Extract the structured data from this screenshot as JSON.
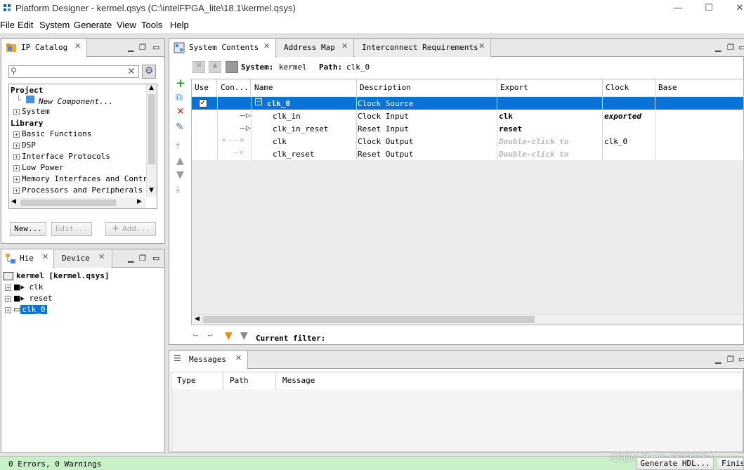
{
  "window": {
    "title": "Platform Designer - kermel.qsys (C:\\intelFPGA_lite\\18.1\\kermel.qsys)",
    "minimize": "—",
    "maximize": "☐",
    "close": "✕"
  },
  "menu": [
    "File",
    "Edit",
    "System",
    "Generate",
    "View",
    "Tools",
    "Help"
  ],
  "ip_catalog": {
    "tab_label": "IP Catalog",
    "search_placeholder": "",
    "project_heading": "Project",
    "new_component": "New Component...",
    "system": "System",
    "library_heading": "Library",
    "library_items": [
      "Basic Functions",
      "DSP",
      "Interface Protocols",
      "Low Power",
      "Memory Interfaces and Control",
      "Processors and Peripherals"
    ],
    "buttons": {
      "new": "New...",
      "edit": "Edit...",
      "add": "Add..."
    }
  },
  "hierarchy": {
    "tab_label": "Hie",
    "device_tab_label": "Device",
    "root": "kermel [kermel.qsys]",
    "items": [
      "clk",
      "reset",
      "clk_0"
    ]
  },
  "system_contents": {
    "tabs": [
      "System Contents",
      "Address Map",
      "Interconnect Requirements"
    ],
    "system_label": "System:",
    "system_value": "kermel",
    "path_label": "Path:",
    "path_value": "clk_0",
    "columns": [
      "Use",
      "Con...",
      "Name",
      "Description",
      "Export",
      "Clock",
      "Base"
    ],
    "rows": [
      {
        "name": "clk_0",
        "description": "Clock Source",
        "export": "",
        "clock": ""
      },
      {
        "name": "clk_in",
        "description": "Clock Input",
        "export": "clk",
        "clock": "exported"
      },
      {
        "name": "clk_in_reset",
        "description": "Reset Input",
        "export": "reset",
        "clock": ""
      },
      {
        "name": "clk",
        "description": "Clock Output",
        "export": "Double-click to",
        "clock": "clk_0"
      },
      {
        "name": "clk_reset",
        "description": "Reset Output",
        "export": "Double-click to",
        "clock": ""
      }
    ],
    "current_filter_label": "Current filter:"
  },
  "messages": {
    "tab_label": "Messages",
    "columns": [
      "Type",
      "Path",
      "Message"
    ]
  },
  "status": {
    "text": "0 Errors, 0 Warnings",
    "generate_hdl": "Generate HDL...",
    "finish": "Finish",
    "watermark": "CSDN @m0_65923764"
  },
  "colors": {
    "selection": "#0a73d8",
    "status_bg": "#c9f0c9",
    "add_icon": "#2ca02c",
    "remove_icon": "#d42020"
  }
}
